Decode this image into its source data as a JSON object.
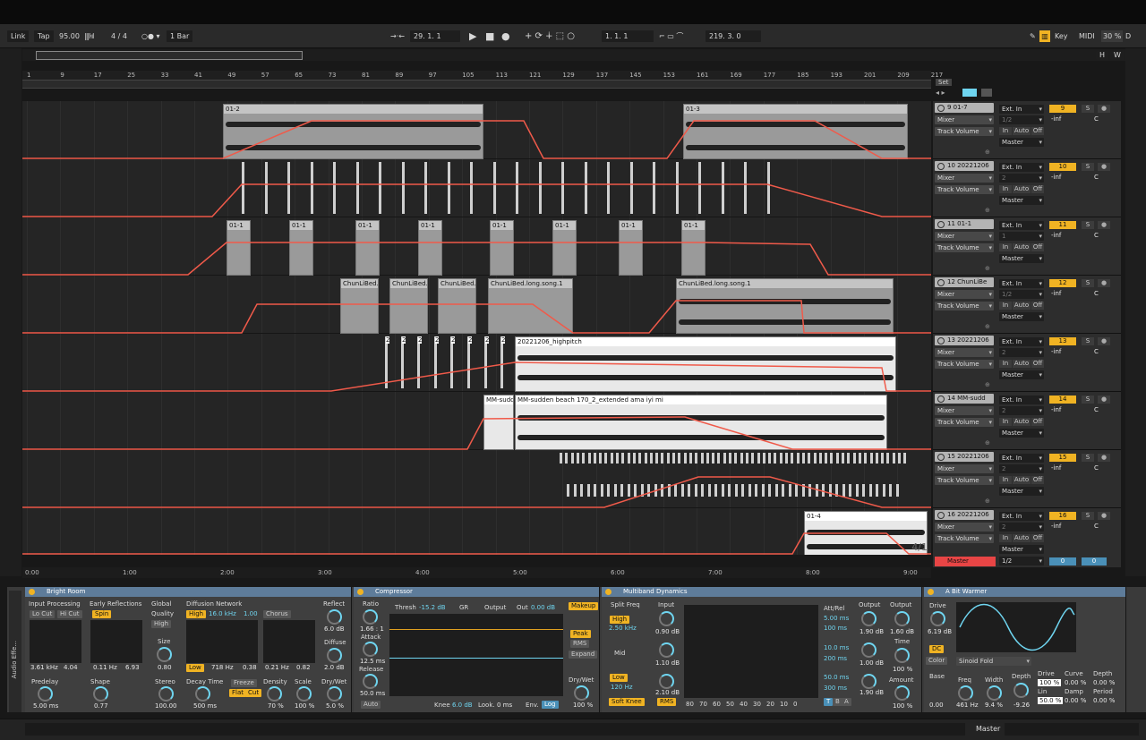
{
  "transport": {
    "link": "Link",
    "tap": "Tap",
    "tempo": "95.00",
    "signature": "4 / 4",
    "quantize": "1 Bar",
    "arr_position": "29.  1.  1",
    "loop_start": "1.  1.  1",
    "loop_length": "219.  3.  0",
    "key": "Key",
    "midi": "MIDI",
    "cpu": "30 %",
    "d": "D",
    "h": "H",
    "w": "W"
  },
  "ruler": {
    "bars": [
      "1",
      "9",
      "17",
      "25",
      "33",
      "41",
      "49",
      "57",
      "65",
      "73",
      "81",
      "89",
      "97",
      "105",
      "113",
      "121",
      "129",
      "137",
      "145",
      "153",
      "161",
      "169",
      "177",
      "185",
      "193",
      "201",
      "209",
      "217"
    ],
    "set_label": "Set"
  },
  "timeline": {
    "times": [
      "0:00",
      "1:00",
      "2:00",
      "3:00",
      "4:00",
      "5:00",
      "6:00",
      "7:00",
      "8:00",
      "9:00"
    ],
    "position_indicator": "4/1"
  },
  "clips": {
    "t9": [
      {
        "name": "01-2"
      },
      {
        "name": "01-3"
      }
    ],
    "t11": [
      "01-1",
      "01-1",
      "01-1",
      "01-1",
      "01-1",
      "01-1",
      "01-1",
      "01-1"
    ],
    "t12": [
      "ChunLiBed.",
      "ChunLiBed.",
      "ChunLiBed.",
      "ChunLiBed.long.song.1",
      "ChunLiBed.long.song.1"
    ],
    "t13_small": "2",
    "t13": "20221206_highpitch",
    "t14a": "MM-sudd",
    "t14b": "MM-sudden beach 170_2_extended ama iyi mi",
    "t16": "01-4"
  },
  "tracks": [
    {
      "name": "9 01-7",
      "num": "9",
      "input": "Ext. In",
      "ch": "1/2",
      "device": "Mixer",
      "param": "Track Volume",
      "out": "Master",
      "vol": "-inf",
      "pan": "C"
    },
    {
      "name": "10 20221206",
      "num": "10",
      "input": "Ext. In",
      "ch": "2",
      "device": "Mixer",
      "param": "Track Volume",
      "out": "Master",
      "vol": "-inf",
      "pan": "C"
    },
    {
      "name": "11 01-1",
      "num": "11",
      "input": "Ext. In",
      "ch": "1",
      "device": "Mixer",
      "param": "Track Volume",
      "out": "Master",
      "vol": "-inf",
      "pan": "C"
    },
    {
      "name": "12 ChunLiBe",
      "num": "12",
      "input": "Ext. In",
      "ch": "1/2",
      "device": "Mixer",
      "param": "Track Volume",
      "out": "Master",
      "vol": "-inf",
      "pan": "C"
    },
    {
      "name": "13 20221206",
      "num": "13",
      "input": "Ext. In",
      "ch": "2",
      "device": "Mixer",
      "param": "Track Volume",
      "out": "Master",
      "vol": "-inf",
      "pan": "C"
    },
    {
      "name": "14 MM-sudd",
      "num": "14",
      "input": "Ext. In",
      "ch": "2",
      "device": "Mixer",
      "param": "Track Volume",
      "out": "Master",
      "vol": "-inf",
      "pan": "C"
    },
    {
      "name": "15 20221206",
      "num": "15",
      "input": "Ext. In",
      "ch": "2",
      "device": "Mixer",
      "param": "Track Volume",
      "out": "Master",
      "vol": "-inf",
      "pan": "C"
    },
    {
      "name": "16 20221206",
      "num": "16",
      "input": "Ext. In",
      "ch": "2",
      "device": "Mixer",
      "param": "Track Volume",
      "out": "Master",
      "vol": "-inf",
      "pan": "C"
    }
  ],
  "track_labels": {
    "in": "In",
    "auto": "Auto",
    "off": "Off",
    "s": "S"
  },
  "master": {
    "name": "Master",
    "ch": "1/2",
    "vol": "0",
    "pan": "0"
  },
  "bright_room": {
    "title": "Bright Room",
    "input_processing": "Input Processing",
    "lo_cut": "Lo Cut",
    "hi_cut": "Hi Cut",
    "freq1": "3.61 kHz",
    "freq2": "4.04",
    "early_reflections": "Early Reflections",
    "spin": "Spin",
    "spin_rate": "0.11 Hz",
    "spin_amt": "6.93",
    "global": "Global",
    "quality": "Quality",
    "quality_val": "High",
    "size": "Size",
    "size_val": "0.80",
    "diffusion_network": "Diffusion Network",
    "high": "High",
    "high_freq": "16.0 kHz",
    "high_val": "1.00",
    "chorus": "Chorus",
    "low": "Low",
    "low_freq": "718 Hz",
    "low_val": "0.38",
    "chorus_rate": "0.21 Hz",
    "chorus_amt": "0.82",
    "reflect": "Reflect",
    "reflect_val": "6.0 dB",
    "diffuse": "Diffuse",
    "diffuse_val": "2.0 dB",
    "predelay": "Predelay",
    "predelay_val": "5.00 ms",
    "shape": "Shape",
    "shape_val": "0.77",
    "stereo": "Stereo",
    "stereo_val": "100.00",
    "decay_time": "Decay Time",
    "decay_val": "500 ms",
    "freeze": "Freeze",
    "flat": "Flat",
    "cut": "Cut",
    "density": "Density",
    "density_val": "70 %",
    "scale": "Scale",
    "scale_val": "100 %",
    "drywet": "Dry/Wet",
    "drywet_val": "5.0 %"
  },
  "compressor": {
    "title": "Compressor",
    "ratio": "Ratio",
    "ratio_val": "1.66 : 1",
    "attack": "Attack",
    "attack_val": "12.5 ms",
    "release": "Release",
    "release_val": "50.0 ms",
    "auto": "Auto",
    "thresh": "Thresh",
    "thresh_val": "-15.2 dB",
    "gr": "GR",
    "output": "Output",
    "out": "Out",
    "out_val": "0.00 dB",
    "makeup": "Makeup",
    "peak": "Peak",
    "rms": "RMS",
    "expand": "Expand",
    "drywet": "Dry/Wet",
    "drywet_val": "100 %",
    "knee": "Knee",
    "knee_val": "6.0 dB",
    "look": "Look.",
    "look_val": "0 ms",
    "env": "Env.",
    "env_val": "Log"
  },
  "multiband": {
    "title": "Multiband Dynamics",
    "split_freq": "Split Freq",
    "high": "High",
    "high_freq": "2.50 kHz",
    "mid": "Mid",
    "low": "Low",
    "low_freq": "120 Hz",
    "soft_knee": "Soft Knee",
    "rms": "RMS",
    "input": "Input",
    "in_high": "0.90 dB",
    "in_mid": "1.10 dB",
    "in_low": "2.10 dB",
    "scale": [
      "80",
      "70",
      "60",
      "50",
      "40",
      "30",
      "20",
      "10",
      "0"
    ],
    "att_rel": "Att/Rel",
    "att1": "5.00 ms",
    "rel1": "100 ms",
    "att2": "10.0 ms",
    "rel2": "200 ms",
    "att3": "50.0 ms",
    "rel3": "300 ms",
    "output": "Output",
    "out_high": "1.90 dB",
    "out_mid": "1.00 dB",
    "out_low": "1.90 dB",
    "output2": "Output",
    "output2_val": "1.60 dB",
    "time": "Time",
    "time_val": "100 %",
    "amount": "Amount",
    "amount_val": "100 %",
    "t": "T",
    "b": "B",
    "a": "A"
  },
  "warmer": {
    "title": "A Bit Warmer",
    "drive": "Drive",
    "drive_val": "6.19 dB",
    "dc": "DC",
    "color": "Color",
    "fold": "Sinoid Fold",
    "base": "Base",
    "base_val": "0.00",
    "freq": "Freq",
    "freq_val": "461 Hz",
    "width": "Width",
    "width_val": "9.4 %",
    "depth": "Depth",
    "depth_val": "-9.26",
    "drive2": "Drive",
    "drive2_val": "100 %",
    "lin": "Lin",
    "lin_val": "50.0 %",
    "curve": "Curve",
    "curve_val": "0.00 %",
    "damp": "Damp",
    "damp_val": "0.00 %",
    "depth2": "Depth",
    "depth2_val": "0.00 %",
    "period": "Period",
    "period_val": "0.00 %"
  },
  "sidebar": {
    "audio_effects": "Audio Effe..."
  },
  "status": {
    "master": "Master"
  }
}
